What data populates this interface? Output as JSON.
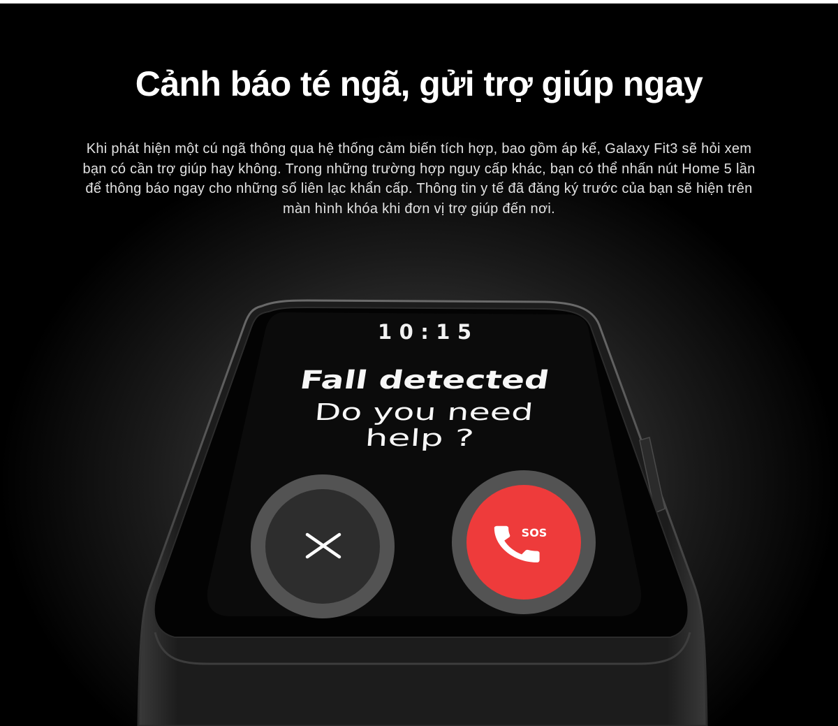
{
  "page": {
    "title": "Cảnh báo té ngã, gửi trợ giúp ngay",
    "intro_lines": [
      "Khi phát hiện một cú ngã thông qua hệ thống cảm biến tích hợp, bao gồm áp kế, Galaxy Fit3 sẽ hỏi xem",
      "bạn có cần trợ giúp hay không. Trong những trường hợp nguy cấp khác, bạn có thể nhấn nút Home 5 lần",
      "để thông báo ngay cho những số liên lạc khẩn cấp. Thông tin y tế đã đăng ký trước của bạn sẽ hiện trên",
      "màn hình khóa khi đơn vị trợ giúp đến nơi."
    ]
  },
  "watch_screen": {
    "time": "10:15",
    "alert_title": "Fall detected",
    "prompt_line_1": "Do you need",
    "prompt_line_2": "help ?",
    "dismiss_icon": "close-icon",
    "sos_icon": "phone-icon",
    "sos_label": "SOS"
  },
  "colors": {
    "background": "#000000",
    "title_text": "#ffffff",
    "sos_red": "#ee3b3b",
    "button_ring": "#535353",
    "dismiss_fill": "#2d2d2d"
  }
}
